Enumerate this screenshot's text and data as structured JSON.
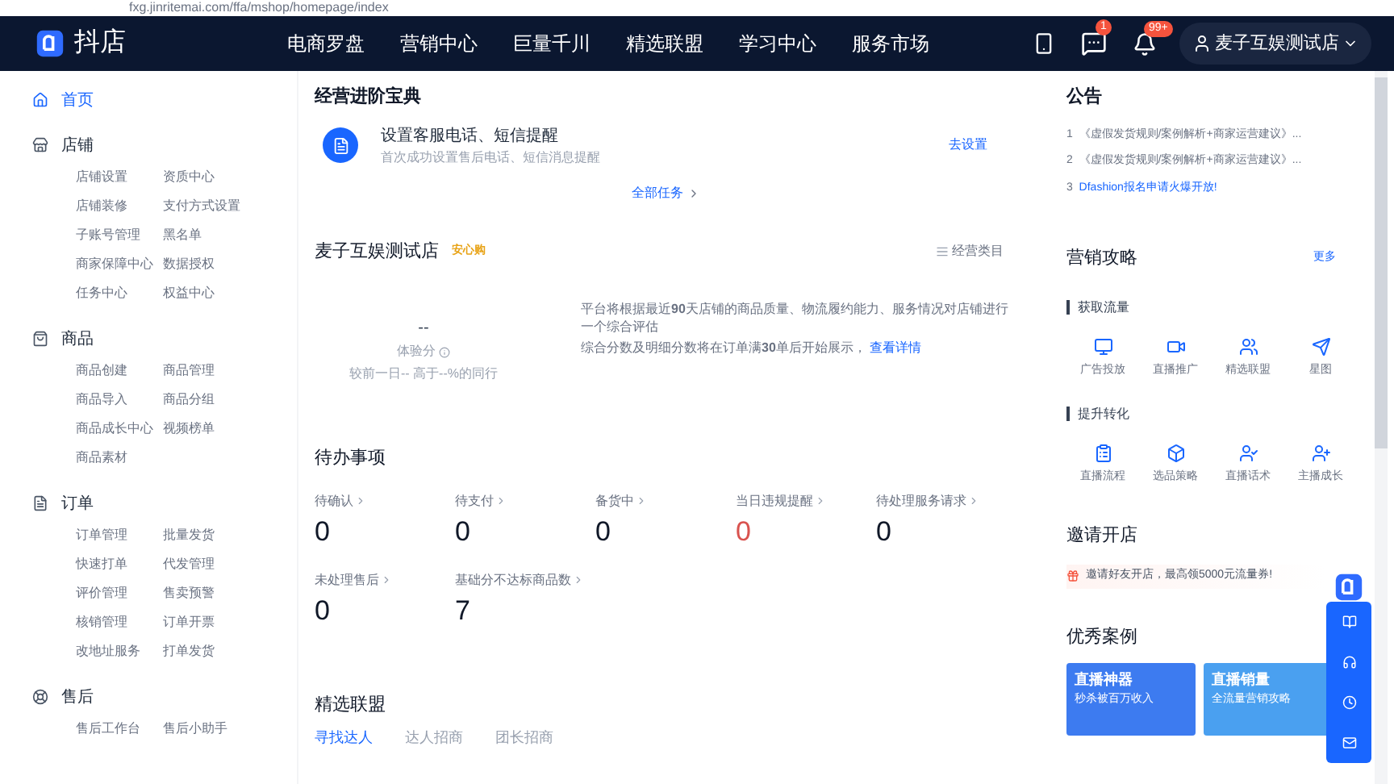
{
  "browser": {
    "url": "fxg.jinritemai.com/ffa/mshop/homepage/index"
  },
  "topnav": {
    "brand": "抖店",
    "links": [
      {
        "label": "电商罗盘"
      },
      {
        "label": "营销中心"
      },
      {
        "label": "巨量千川"
      },
      {
        "label": "精选联盟"
      },
      {
        "label": "学习中心"
      },
      {
        "label": "服务市场"
      }
    ],
    "message_badge": "1",
    "bell_badge": "99+",
    "account": "麦子互娱测试店"
  },
  "sidebar": {
    "home": {
      "label": "首页",
      "selected": true
    },
    "groups": [
      {
        "title": "店铺",
        "items": [
          "店铺设置",
          "资质中心",
          "店铺装修",
          "支付方式设置",
          "子账号管理",
          "黑名单",
          "商家保障中心",
          "数据授权",
          "任务中心",
          "权益中心"
        ]
      },
      {
        "title": "商品",
        "items": [
          "商品创建",
          "商品管理",
          "商品导入",
          "商品分组",
          "商品成长中心",
          "视频榜单",
          "商品素材"
        ]
      },
      {
        "title": "订单",
        "items": [
          "订单管理",
          "批量发货",
          "快速打单",
          "代发管理",
          "评价管理",
          "售卖预警",
          "核销管理",
          "订单开票",
          "改地址服务",
          "打单发货"
        ]
      },
      {
        "title": "售后",
        "items": [
          "售后工作台",
          "售后小助手"
        ]
      }
    ]
  },
  "guide": {
    "title": "经营进阶宝典",
    "task_title": "设置客服电话、短信提醒",
    "task_desc": "首次成功设置售后电话、短信消息提醒",
    "action": "去设置",
    "all_tasks": "全部任务"
  },
  "store": {
    "name": "麦子互娱测试店",
    "badge": "安心购",
    "category_link": "经营类目",
    "score": "--",
    "score_label": "体验分",
    "compare": "较前一日-- 高于--%的同行",
    "desc1": "平台将根据最近**90**天店铺的商品质量、物流履约能力、服务情况对店铺进行一个综合评估",
    "desc2": "综合分数及明细分数将在订单满**30**单后开始展示，",
    "detail_link": "查看详情"
  },
  "todo": {
    "title": "待办事项",
    "items": [
      {
        "label": "待确认",
        "value": "0",
        "alert": false
      },
      {
        "label": "待支付",
        "value": "0",
        "alert": false
      },
      {
        "label": "备货中",
        "value": "0",
        "alert": false
      },
      {
        "label": "当日违规提醒",
        "value": "0",
        "alert": true
      },
      {
        "label": "待处理服务请求",
        "value": "0",
        "alert": false
      },
      {
        "label": "未处理售后",
        "value": "0",
        "alert": false
      },
      {
        "label": "基础分不达标商品数",
        "value": "7",
        "alert": false
      }
    ]
  },
  "alliance": {
    "title": "精选联盟",
    "tabs": [
      {
        "label": "寻找达人",
        "selected": true
      },
      {
        "label": "达人招商",
        "selected": false
      },
      {
        "label": "团长招商",
        "selected": false
      }
    ]
  },
  "notice": {
    "title": "公告",
    "items": [
      {
        "num": "1",
        "text": "《虚假发货规则/案例解析+商家运营建议》..."
      },
      {
        "num": "2",
        "text": "《虚假发货规则/案例解析+商家运营建议》..."
      },
      {
        "num": "3",
        "text": "Dfashion报名申请火爆开放!"
      }
    ]
  },
  "marketing": {
    "title": "营销攻略",
    "more": "更多",
    "sections": [
      {
        "title": "获取流量",
        "items": [
          "广告投放",
          "直播推广",
          "精选联盟",
          "星图"
        ]
      },
      {
        "title": "提升转化",
        "items": [
          "直播流程",
          "选品策略",
          "直播话术",
          "主播成长"
        ]
      }
    ]
  },
  "invite": {
    "title": "邀请开店",
    "text": "邀请好友开店，最高领5000元流量券!"
  },
  "cases": {
    "title": "优秀案例",
    "cards": [
      {
        "title": "直播神器",
        "subtitle": "秒杀被百万收入"
      },
      {
        "title": "直播销量",
        "subtitle": "全流量营销攻略"
      }
    ]
  }
}
